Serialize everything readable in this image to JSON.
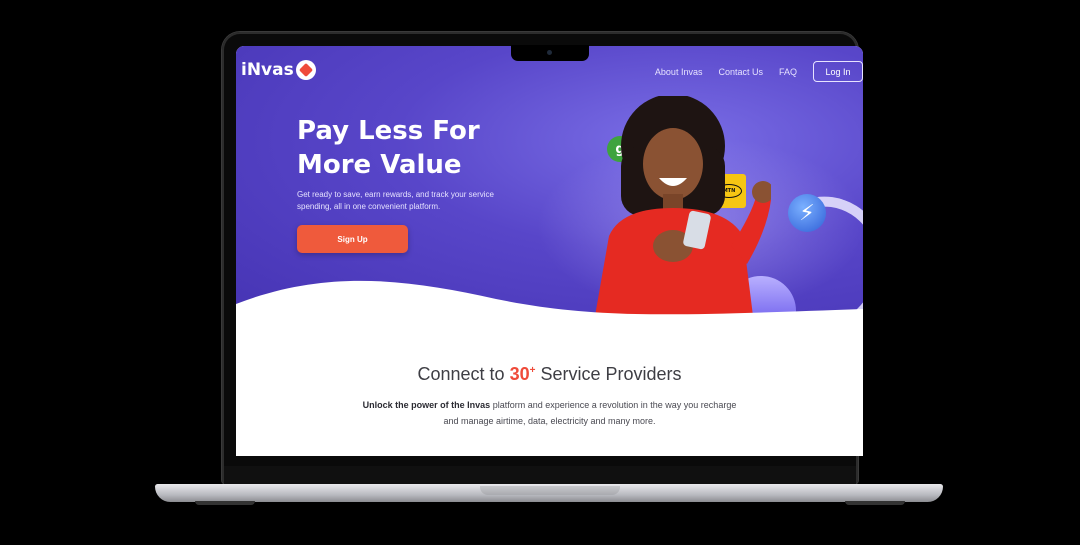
{
  "brand": {
    "logo_text": "iNvas"
  },
  "nav": {
    "items": [
      "About Invas",
      "Contact Us",
      "FAQ"
    ],
    "login_label": "Log In"
  },
  "hero": {
    "headline": "Pay Less For More Value",
    "subtext": "Get ready to save, earn rewards, and track your service spending, all in one convenient platform.",
    "cta_label": "Sign Up"
  },
  "providers": {
    "title_prefix": "Connect to ",
    "title_number": "30",
    "title_sup": "+",
    "title_suffix": " Service Providers",
    "desc_bold": "Unlock the power of the Invas",
    "desc_rest": " platform and experience a revolution in the way you recharge and manage airtime, data, electricity and many more."
  },
  "icons": {
    "glo": "glo-logo-icon",
    "mtn": "mtn-logo-icon",
    "bolt": "lightning-bolt-icon",
    "mtn_text": "MTN",
    "glo_text": "g",
    "bolt_glyph": "⚡"
  },
  "colors": {
    "primary": "#4f3fc4",
    "accent": "#ef5a3c",
    "text": "#3e3e44"
  }
}
